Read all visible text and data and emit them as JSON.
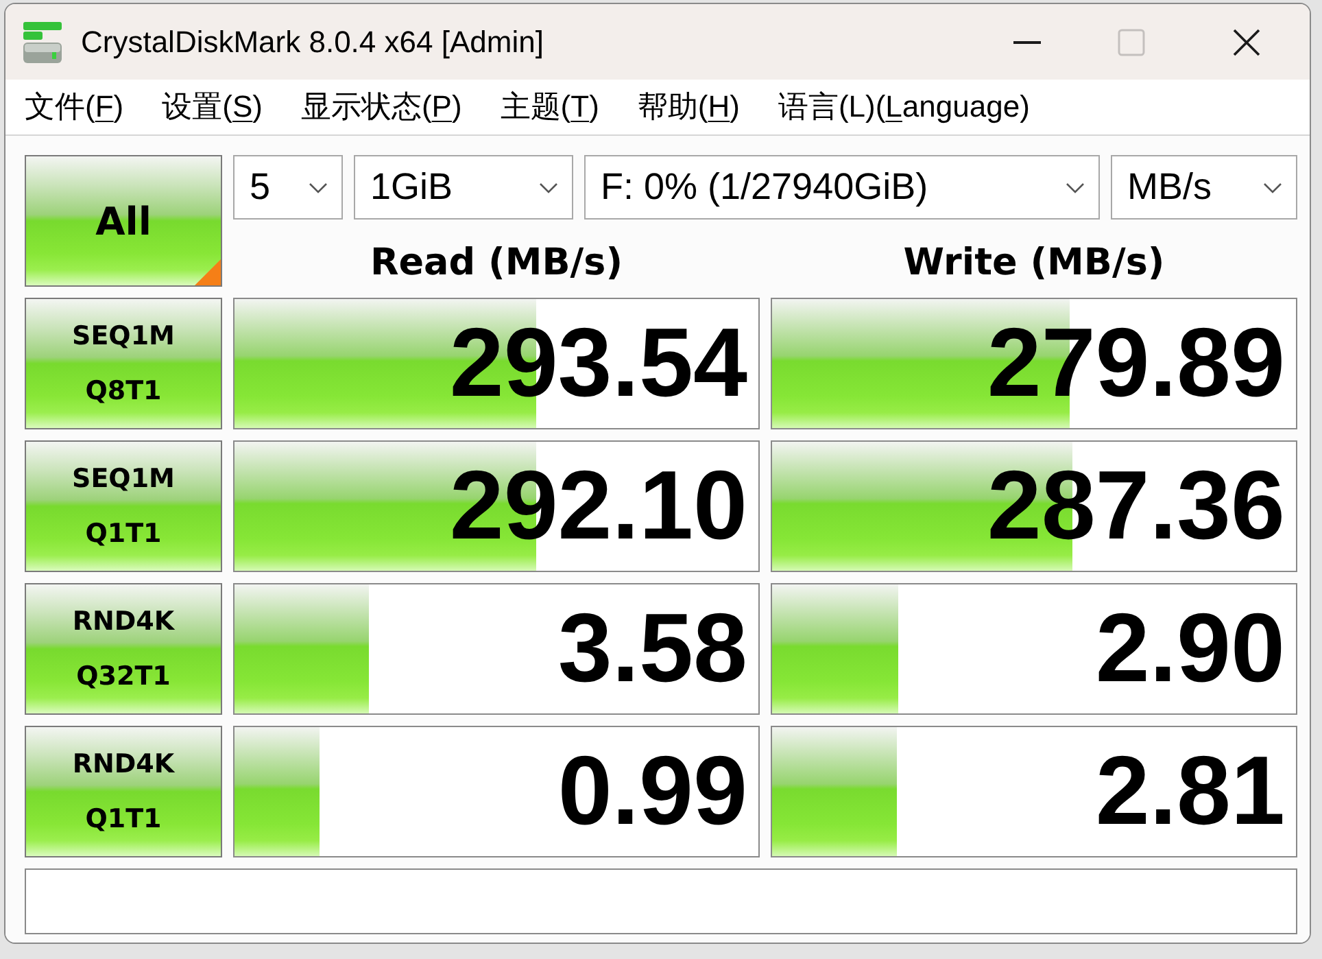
{
  "window": {
    "title": "CrystalDiskMark 8.0.4 x64 [Admin]",
    "controls": [
      {
        "kind": "minimize",
        "disabled": false
      },
      {
        "kind": "maximize",
        "disabled": true
      },
      {
        "kind": "close",
        "disabled": false
      }
    ]
  },
  "menu": [
    {
      "prefix": "文件(",
      "key": "F",
      "suffix": ")"
    },
    {
      "prefix": "设置(",
      "key": "S",
      "suffix": ")"
    },
    {
      "prefix": "显示状态(",
      "key": "P",
      "suffix": ")"
    },
    {
      "prefix": "主题(",
      "key": "T",
      "suffix": ")"
    },
    {
      "prefix": "帮助(",
      "key": "H",
      "suffix": ")"
    },
    {
      "prefix": "语言(L)(",
      "key": "L",
      "suffix": "anguage)"
    }
  ],
  "toolbar": {
    "run_all": {
      "label": "All"
    },
    "dropdowns": [
      {
        "value": "5"
      },
      {
        "value": "1GiB"
      },
      {
        "value": "F: 0% (1/27940GiB)"
      },
      {
        "value": "MB/s"
      }
    ]
  },
  "columns": [
    "Read (MB/s)",
    "Write (MB/s)"
  ],
  "tests": [
    {
      "line_1": "SEQ1M",
      "line_2": "Q8T1",
      "read": {
        "value": "293.54",
        "level": 0.575
      },
      "write": {
        "value": "279.89",
        "level": 0.569
      }
    },
    {
      "line_1": "SEQ1M",
      "line_2": "Q1T1",
      "read": {
        "value": "292.10",
        "level": 0.575
      },
      "write": {
        "value": "287.36",
        "level": 0.572
      }
    },
    {
      "line_1": "RND4K",
      "line_2": "Q32T1",
      "read": {
        "value": "3.58",
        "level": 0.256
      },
      "write": {
        "value": "2.90",
        "level": 0.24
      }
    },
    {
      "line_1": "RND4K",
      "line_2": "Q1T1",
      "read": {
        "value": "0.99",
        "level": 0.162
      },
      "write": {
        "value": "2.81",
        "level": 0.238
      }
    }
  ]
}
